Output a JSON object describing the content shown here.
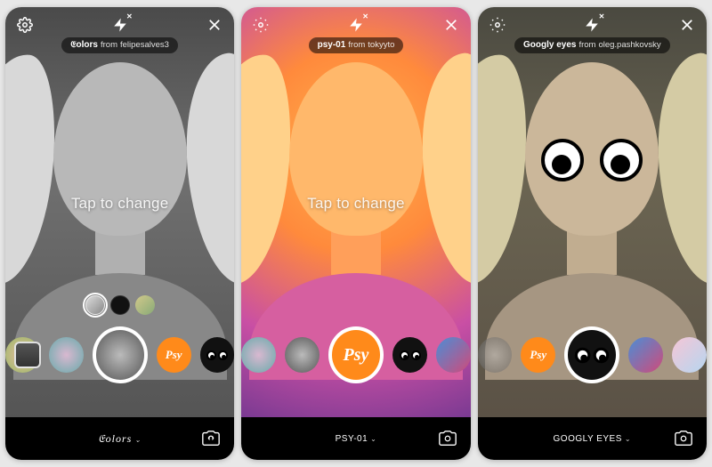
{
  "screens": [
    {
      "filter_name": "𝔈olors",
      "filter_author": "felipesalves3",
      "tap_hint": "Tap to change",
      "bottom_effect_name": "𝔈olors",
      "bottom_effect_style": "italic"
    },
    {
      "filter_name": "psy-01",
      "filter_author": "tokyyto",
      "tap_hint": "Tap to change",
      "bottom_effect_name": "PSY-01",
      "bottom_effect_style": "normal"
    },
    {
      "filter_name": "Googly eyes",
      "filter_author": "oleg.pashkovsky",
      "tap_hint": "",
      "bottom_effect_name": "GOOGLY EYES",
      "bottom_effect_style": "normal"
    }
  ],
  "common": {
    "from_word": "from",
    "chevron": "⌄"
  }
}
